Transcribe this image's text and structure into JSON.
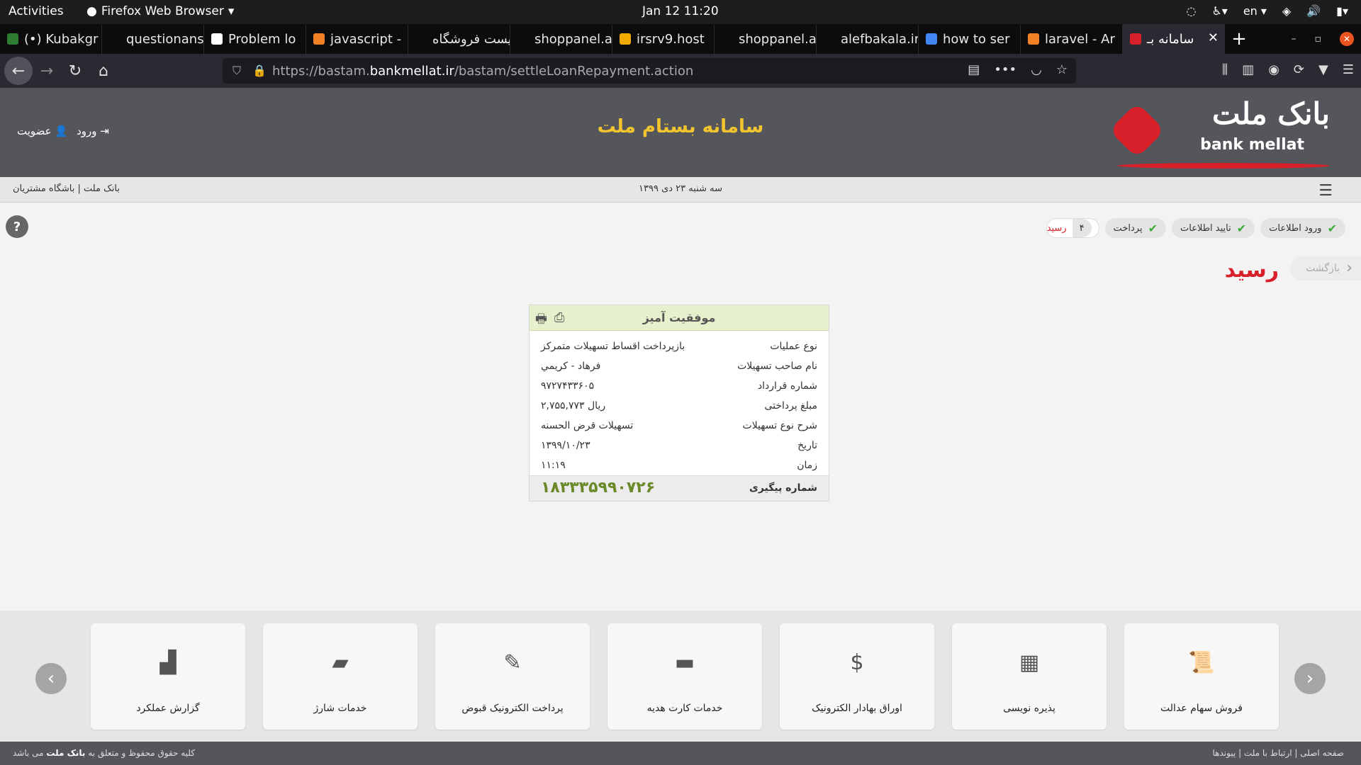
{
  "system_bar": {
    "activities": "Activities",
    "app": "Firefox Web Browser",
    "clock": "Jan 12  11:20",
    "lang": "en"
  },
  "tabs": [
    {
      "label": "(•) Kubakgr",
      "favicon_color": "#2e7d32"
    },
    {
      "label": "questionansw",
      "favicon_color": "#0c0c0d"
    },
    {
      "label": "Problem lo",
      "favicon_color": "#ffffff"
    },
    {
      "label": "javascript -",
      "favicon_color": "#f48024"
    },
    {
      "label": "لیست فروشگاه",
      "favicon_color": "#0c0c0d"
    },
    {
      "label": "shoppanel.ale",
      "favicon_color": "#0c0c0d"
    },
    {
      "label": "irsrv9.host",
      "favicon_color": "#f2a900"
    },
    {
      "label": "shoppanel.ale",
      "favicon_color": "#0c0c0d"
    },
    {
      "label": "alefbakala.ir/s",
      "favicon_color": "#0c0c0d"
    },
    {
      "label": "how to ser",
      "favicon_color": "#4285f4"
    },
    {
      "label": "laravel - Ar",
      "favicon_color": "#f48024"
    },
    {
      "label": "سامانه بـ",
      "favicon_color": "#d8202a"
    }
  ],
  "url": {
    "prefix": "https://bastam.",
    "host": "bankmellat.ir",
    "path": "/bastam/settleLoanRepayment.action"
  },
  "header": {
    "title": "سامانه بستام ملت",
    "logo_fa": "بانک ملت",
    "logo_en": "bank mellat",
    "login": "ورود",
    "register": "عضویت"
  },
  "subbar": {
    "left": "بانک ملت | باشگاه مشتریان",
    "date": "سه شنبه ۲۳ دی ۱۳۹۹"
  },
  "steps": [
    "ورود اطلاعات",
    "تایید اطلاعات",
    "پرداخت"
  ],
  "current_step": {
    "num": "۴",
    "label": "رسید"
  },
  "page_title": "رسید",
  "back_label": "بازگشت",
  "receipt": {
    "status": "موفقیت آمیز",
    "rows": [
      {
        "k": "نوع عملیات",
        "v": "بازپرداخت اقساط تسهیلات متمرکز"
      },
      {
        "k": "نام صاحب تسهیلات",
        "v": "فرهاد - کريمي"
      },
      {
        "k": "شماره قرارداد",
        "v": "۹۷۲۷۴۳۳۶۰۵"
      },
      {
        "k": "مبلغ پرداختی",
        "v": "۲,۷۵۵,۷۷۳ ريال"
      },
      {
        "k": "شرح نوع تسهیلات",
        "v": "تسهیلات قرض الحسنه"
      },
      {
        "k": "تاریخ",
        "v": "۱۳۹۹/۱۰/۲۳"
      },
      {
        "k": "زمان",
        "v": "۱۱:۱۹"
      }
    ],
    "tracking_label": "شماره پیگیری",
    "tracking_value": "۱۸۳۳۳۵۹۹۰۷۲۶"
  },
  "services": [
    "فروش سهام عدالت",
    "پذیره نویسی",
    "اوراق بهادار الکترونیک",
    "خدمات کارت هدیه",
    "پرداخت الکترونیک قبوض",
    "خدمات شارژ",
    "گزارش عملکرد"
  ],
  "service_icons": [
    "doc-stamp-icon",
    "etf-icon",
    "dollar-doc-icon",
    "gift-card-icon",
    "bill-icon",
    "charge-card-icon",
    "chart-icon"
  ],
  "footer": {
    "left_prefix": "کلیه حقوق محفوظ و متعلق به ",
    "left_bank": "بانک ملت",
    "left_suffix": " می باشد",
    "right": "صفحه اصلی | ارتباط با ملت | پیوندها"
  },
  "colors": {
    "accent_red": "#d8202a",
    "title_yellow": "#f2c52e",
    "success_green": "#3cab3c"
  }
}
